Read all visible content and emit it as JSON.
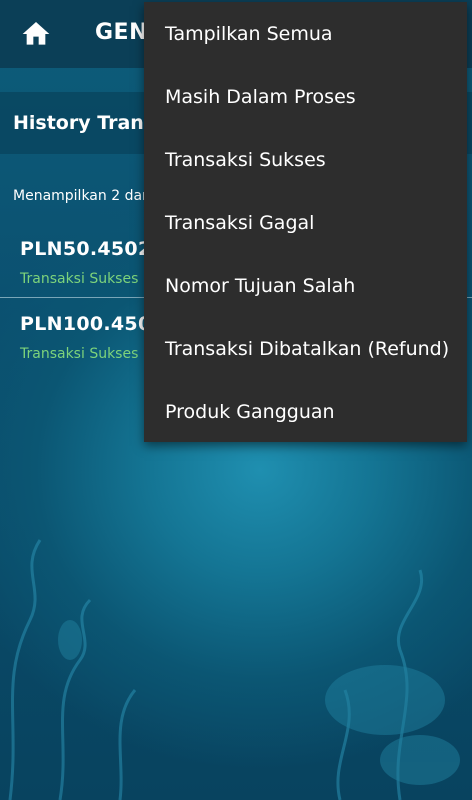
{
  "app_bar": {
    "title": "GEN",
    "home_icon": "home-icon"
  },
  "section": {
    "title": "History Tran"
  },
  "info_text": "Menampilkan 2 dar",
  "transactions": [
    {
      "code": "PLN50.4502",
      "status": "Transaksi Sukses"
    },
    {
      "code": "PLN100.450",
      "status": "Transaksi Sukses"
    }
  ],
  "filter_menu": {
    "items": [
      "Tampilkan Semua",
      "Masih Dalam Proses",
      "Transaksi Sukses",
      "Transaksi Gagal",
      "Nomor Tujuan Salah",
      "Transaksi Dibatalkan (Refund)",
      "Produk Gangguan"
    ]
  },
  "colors": {
    "app_bar": "#0b3f57",
    "menu_bg": "#2d2d2d",
    "success_text": "#7dd37b"
  }
}
